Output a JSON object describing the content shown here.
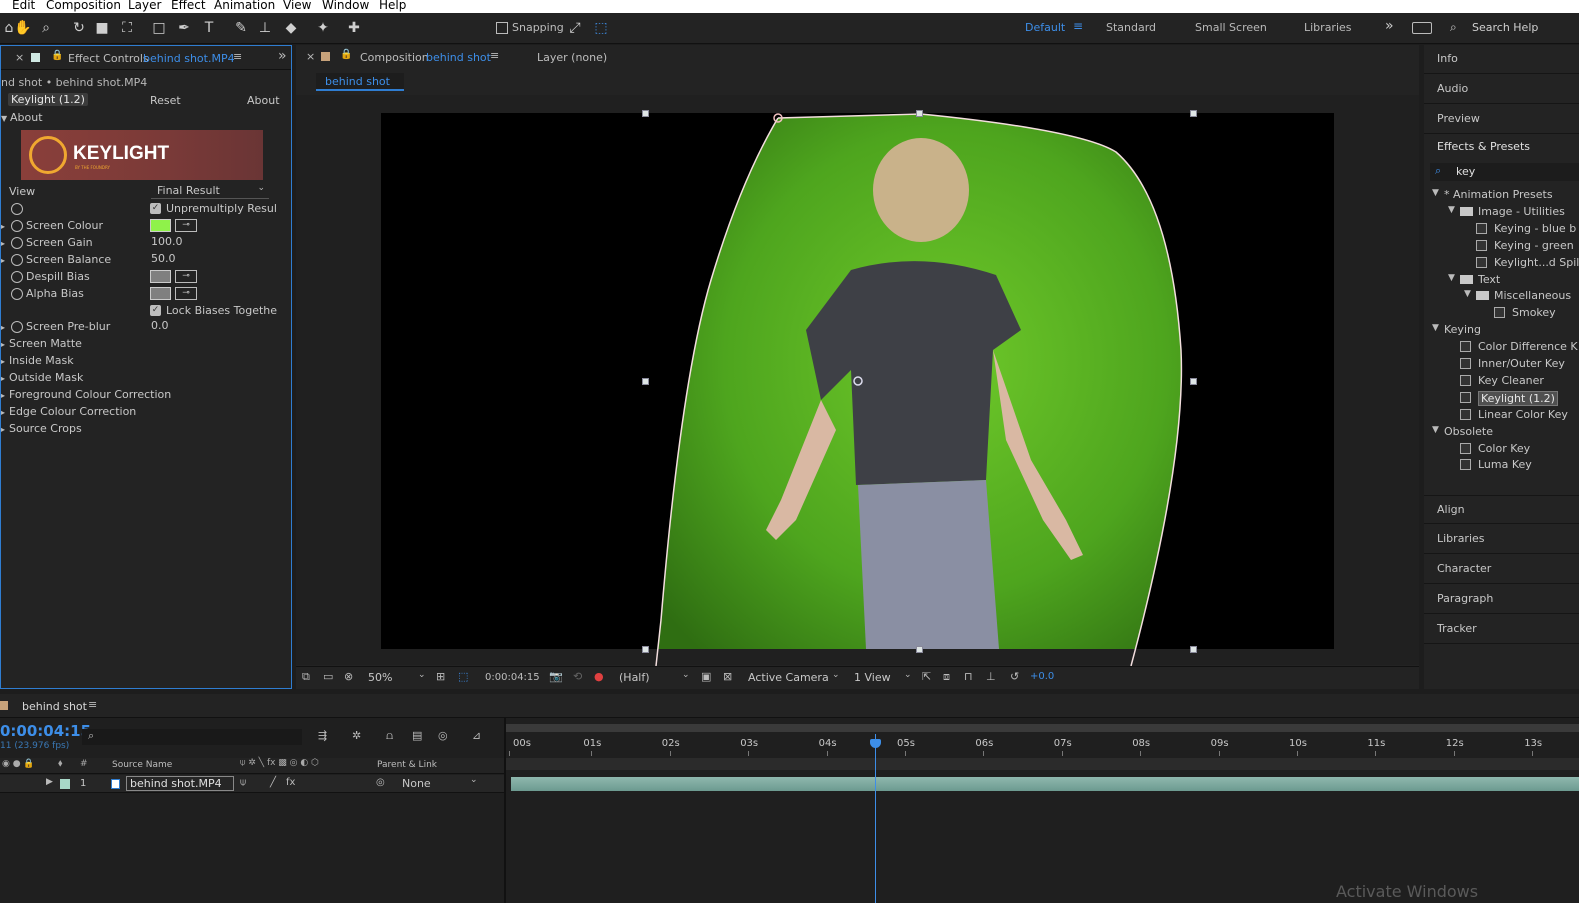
{
  "menu": [
    "Edit",
    "Composition",
    "Layer",
    "Effect",
    "Animation",
    "View",
    "Window",
    "Help"
  ],
  "toolbar": {
    "snapping_label": "Snapping",
    "workspaces": [
      "Default",
      "Standard",
      "Small Screen",
      "Libraries"
    ],
    "active_workspace": "Default",
    "search_help": "Search Help"
  },
  "effect_controls": {
    "tab_title": "Effect Controls",
    "tab_layer": "behind shot.MP4",
    "breadcrumb": "nd shot • behind shot.MP4",
    "effect_name": "Keylight (1.2)",
    "reset": "Reset",
    "about": "About",
    "about_section": "About",
    "logo_text": "KEYLIGHT",
    "logo_sub": "BY THE FOUNDRY",
    "view_label": "View",
    "view_value": "Final Result",
    "unpremultiply": "Unpremultiply Resul",
    "screen_colour": "Screen Colour",
    "screen_colour_hex": "#8ff24a",
    "screen_gain": "Screen Gain",
    "screen_gain_value": "100.0",
    "screen_balance": "Screen Balance",
    "screen_balance_value": "50.0",
    "despill_bias": "Despill Bias",
    "alpha_bias": "Alpha Bias",
    "lock_biases": "Lock Biases Togethe",
    "screen_preblur": "Screen Pre-blur",
    "screen_preblur_value": "0.0",
    "groups": [
      "Screen Matte",
      "Inside Mask",
      "Outside Mask",
      "Foreground Colour Correction",
      "Edge Colour Correction",
      "Source Crops"
    ]
  },
  "composition": {
    "tab_title": "Composition",
    "tab_comp": "behind shot",
    "layer_tab": "Layer  (none)",
    "subtab": "behind shot",
    "zoom": "50%",
    "timecode": "0:00:04:15",
    "resolution": "(Half)",
    "camera": "Active Camera",
    "views": "1 View",
    "exposure": "+0.0"
  },
  "right_panel": {
    "sections_top": [
      "Info",
      "Audio",
      "Preview",
      "Effects & Presets"
    ],
    "search_value": "key",
    "tree": [
      {
        "label": "* Animation Presets",
        "level": 0,
        "type": "folder-open"
      },
      {
        "label": "Image - Utilities",
        "level": 1,
        "type": "folder"
      },
      {
        "label": "Keying - blue b",
        "level": 2,
        "type": "preset"
      },
      {
        "label": "Keying - green",
        "level": 2,
        "type": "preset"
      },
      {
        "label": "Keylight...d Spill",
        "level": 2,
        "type": "preset"
      },
      {
        "label": "Text",
        "level": 1,
        "type": "folder"
      },
      {
        "label": "Miscellaneous",
        "level": 2,
        "type": "folder"
      },
      {
        "label": "Smokey",
        "level": 3,
        "type": "preset"
      },
      {
        "label": "Keying",
        "level": 0,
        "type": "category"
      },
      {
        "label": "Color Difference K",
        "level": 1,
        "type": "effect"
      },
      {
        "label": "Inner/Outer Key",
        "level": 1,
        "type": "effect"
      },
      {
        "label": "Key Cleaner",
        "level": 1,
        "type": "effect"
      },
      {
        "label": "Keylight (1.2)",
        "level": 1,
        "type": "effect-selected"
      },
      {
        "label": "Linear Color Key",
        "level": 1,
        "type": "effect"
      },
      {
        "label": "Obsolete",
        "level": 0,
        "type": "category"
      },
      {
        "label": "Color Key",
        "level": 1,
        "type": "effect"
      },
      {
        "label": "Luma Key",
        "level": 1,
        "type": "effect"
      }
    ],
    "sections_bottom": [
      "Align",
      "Libraries",
      "Character",
      "Paragraph",
      "Tracker"
    ]
  },
  "timeline": {
    "tab": "behind shot",
    "timecode": "0:00:04:15",
    "fps": "11 (23.976 fps)",
    "col_source": "Source Name",
    "col_parent": "Parent & Link",
    "layer_number": "1",
    "layer_name": "behind shot.MP4",
    "parent_value": "None",
    "ticks": [
      "00s",
      "01s",
      "02s",
      "03s",
      "04s",
      "05s",
      "06s",
      "07s",
      "08s",
      "09s",
      "10s",
      "11s",
      "12s",
      "13s"
    ]
  },
  "watermark": "Activate Windows"
}
